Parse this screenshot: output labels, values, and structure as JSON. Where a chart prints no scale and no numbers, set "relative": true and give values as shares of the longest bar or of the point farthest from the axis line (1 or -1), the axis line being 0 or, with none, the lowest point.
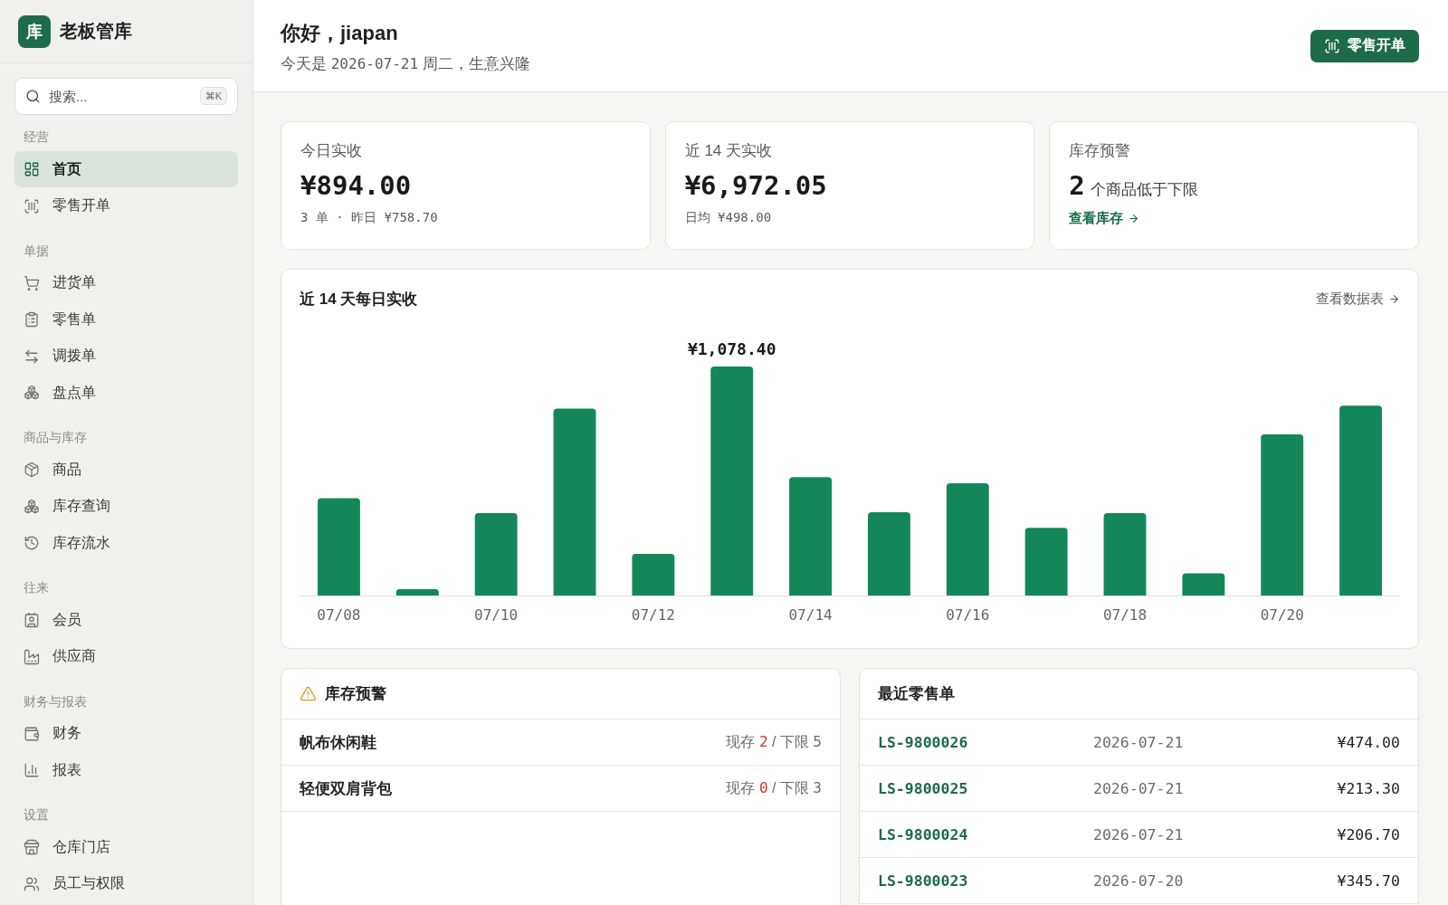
{
  "sidebar": {
    "brand": {
      "logo_text": "库",
      "name": "老板管库"
    },
    "search": {
      "placeholder": "搜索...",
      "shortcut": "⌘K"
    },
    "groups": [
      {
        "title": "经营",
        "items": [
          {
            "label": "首页",
            "selected": true
          },
          {
            "label": "零售开单",
            "selected": false
          }
        ]
      },
      {
        "title": "单据",
        "items": [
          {
            "label": "进货单",
            "selected": false
          },
          {
            "label": "零售单",
            "selected": false
          },
          {
            "label": "调拨单",
            "selected": false
          },
          {
            "label": "盘点单",
            "selected": false
          }
        ]
      },
      {
        "title": "商品与库存",
        "items": [
          {
            "label": "商品",
            "selected": false
          },
          {
            "label": "库存查询",
            "selected": false
          },
          {
            "label": "库存流水",
            "selected": false
          }
        ]
      },
      {
        "title": "往来",
        "items": [
          {
            "label": "会员",
            "selected": false
          },
          {
            "label": "供应商",
            "selected": false
          }
        ]
      },
      {
        "title": "财务与报表",
        "items": [
          {
            "label": "财务",
            "selected": false
          },
          {
            "label": "报表",
            "selected": false
          }
        ]
      },
      {
        "title": "设置",
        "items": [
          {
            "label": "仓库门店",
            "selected": false
          },
          {
            "label": "员工与权限",
            "selected": false
          }
        ]
      }
    ]
  },
  "header": {
    "greeting": "你好，jiapan",
    "date_line": {
      "prefix": "今天是",
      "date": "2026-07-21",
      "suffix": "周二，生意兴隆"
    },
    "action_button": "零售开单"
  },
  "stat_cards": [
    {
      "kind": "amount",
      "label": "今日实收",
      "value": "¥894.00",
      "detail": "3 单 · 昨日 ¥758.70"
    },
    {
      "kind": "amount",
      "label": "近 14 天实收",
      "value": "¥6,972.05",
      "detail": "日均 ¥498.00"
    },
    {
      "kind": "alert",
      "label": "库存预警",
      "value": "2",
      "unit": "个商品低于下限",
      "link": "查看库存"
    }
  ],
  "revenue_chart": {
    "link": "查看数据表",
    "chart_data": {
      "type": "bar",
      "title": "近 14 天每日实收",
      "categories": [
        "07/08",
        null,
        "07/10",
        null,
        "07/12",
        null,
        "07/14",
        null,
        "07/16",
        null,
        "07/18",
        null,
        "07/20",
        null
      ],
      "values": [
        0.425,
        0.028,
        0.36,
        0.816,
        0.182,
        1,
        0.517,
        0.364,
        0.49,
        0.295,
        0.36,
        0.097,
        0.704,
        0.829
      ],
      "relative": true,
      "annotations": [
        "¥1,078.40"
      ]
    }
  },
  "stock_alerts": {
    "title": "库存预警",
    "rows": [
      {
        "name": "帆布休闲鞋",
        "stock_label": "现存",
        "stock": "2",
        "limit_label": "/ 下限",
        "limit": "5",
        "low": true
      },
      {
        "name": "轻便双肩背包",
        "stock_label": "现存",
        "stock": "0",
        "limit_label": "/ 下限",
        "limit": "3",
        "low": true
      }
    ]
  },
  "recent_sales": {
    "title": "最近零售单",
    "rows": [
      {
        "order_no": "LS-9800026",
        "date": "2026-07-21",
        "amount": "¥474.00"
      },
      {
        "order_no": "LS-9800025",
        "date": "2026-07-21",
        "amount": "¥213.30"
      },
      {
        "order_no": "LS-9800024",
        "date": "2026-07-21",
        "amount": "¥206.70"
      },
      {
        "order_no": "LS-9800023",
        "date": "2026-07-20",
        "amount": "¥345.70"
      }
    ]
  }
}
